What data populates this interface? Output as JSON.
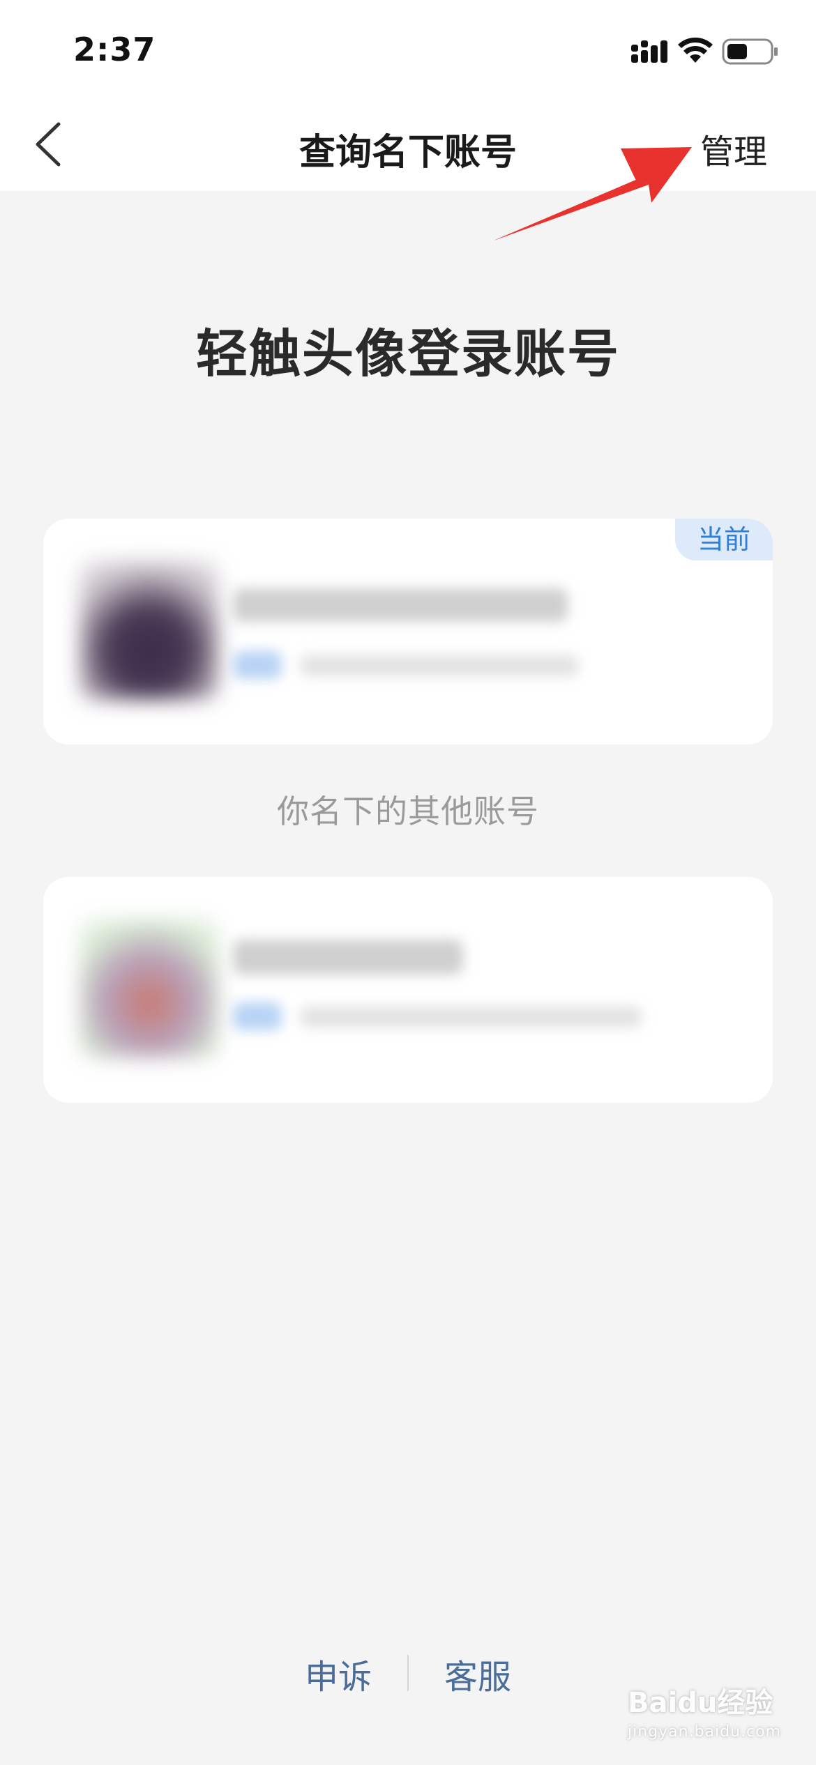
{
  "status_bar": {
    "time": "2:37"
  },
  "nav": {
    "title": "查询名下账号",
    "manage_label": "管理"
  },
  "headline": "轻触头像登录账号",
  "current_account": {
    "badge": "当前"
  },
  "section_label": "你名下的其他账号",
  "footer": {
    "appeal_label": "申诉",
    "support_label": "客服"
  },
  "watermark": {
    "brand": "Baidu经验",
    "url": "jingyan.baidu.com"
  },
  "colors": {
    "background": "#f4f4f4",
    "card": "#ffffff",
    "badge_bg": "#ddeaf9",
    "badge_text": "#2f7fd8",
    "footer_link": "#4a6c98",
    "annotation_arrow": "#e8322e"
  }
}
